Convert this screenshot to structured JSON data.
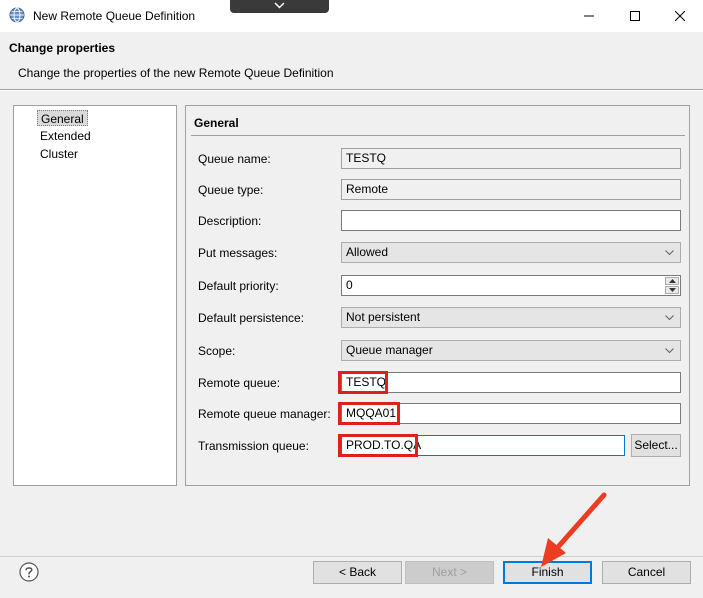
{
  "window": {
    "title": "New Remote Queue Definition",
    "icon": "globe-icon",
    "controls": [
      "minimize-icon",
      "maximize-icon",
      "close-icon"
    ]
  },
  "header": {
    "title": "Change properties",
    "description": "Change the properties of the new Remote Queue Definition"
  },
  "nav": {
    "items": [
      {
        "label": "General",
        "selected": true
      },
      {
        "label": "Extended",
        "selected": false
      },
      {
        "label": "Cluster",
        "selected": false
      }
    ]
  },
  "panel": {
    "title": "General",
    "fields": {
      "queue_name": {
        "label": "Queue name:",
        "value": "TESTQ"
      },
      "queue_type": {
        "label": "Queue type:",
        "value": "Remote"
      },
      "description": {
        "label": "Description:",
        "value": ""
      },
      "put_messages": {
        "label": "Put messages:",
        "value": "Allowed"
      },
      "default_priority": {
        "label": "Default priority:",
        "value": "0"
      },
      "default_persistence": {
        "label": "Default persistence:",
        "value": "Not persistent"
      },
      "scope": {
        "label": "Scope:",
        "value": "Queue manager"
      },
      "remote_queue": {
        "label": "Remote queue:",
        "value": "TESTQ"
      },
      "remote_queue_manager": {
        "label": "Remote queue manager:",
        "value": "MQQA01"
      },
      "transmission_queue": {
        "label": "Transmission queue:",
        "value": "PROD.TO.QA"
      }
    },
    "select_button": "Select..."
  },
  "footer": {
    "back": "< Back",
    "next": "Next >",
    "finish": "Finish",
    "cancel": "Cancel"
  },
  "colors": {
    "highlight": "#e0201c",
    "default_button_border": "#0078d7"
  }
}
